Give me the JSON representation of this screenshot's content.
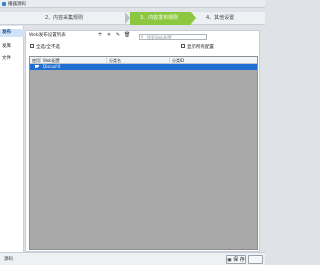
{
  "window": {
    "title": "播器源码"
  },
  "steps": [
    {
      "label": "2、内容采集规则",
      "active": false
    },
    {
      "label": "3、内容发布规则",
      "active": true
    },
    {
      "label": "4、其他设置",
      "active": false
    }
  ],
  "sidebar": {
    "items": [
      {
        "label": "发布",
        "selected": true
      },
      {
        "label": "发库",
        "selected": false
      },
      {
        "label": "文件",
        "selected": false
      }
    ]
  },
  "panel": {
    "title": "Web发布设置列表",
    "search_placeholder": "搜索Web配置",
    "select_all_label": "全选/全不选",
    "show_all_label": "显示所有配置"
  },
  "grid": {
    "columns": [
      "使用",
      "Web配置",
      "分类名",
      "分类ID"
    ],
    "rows": [
      {
        "checked": true,
        "config": "Discuz!X",
        "category": "",
        "category_id": ""
      }
    ]
  },
  "status": {
    "label": "源码",
    "save_label": "保 存",
    "save_icon": "save-icon"
  },
  "colors": {
    "accent": "#8cc83f",
    "selection": "#1e6fd1"
  }
}
